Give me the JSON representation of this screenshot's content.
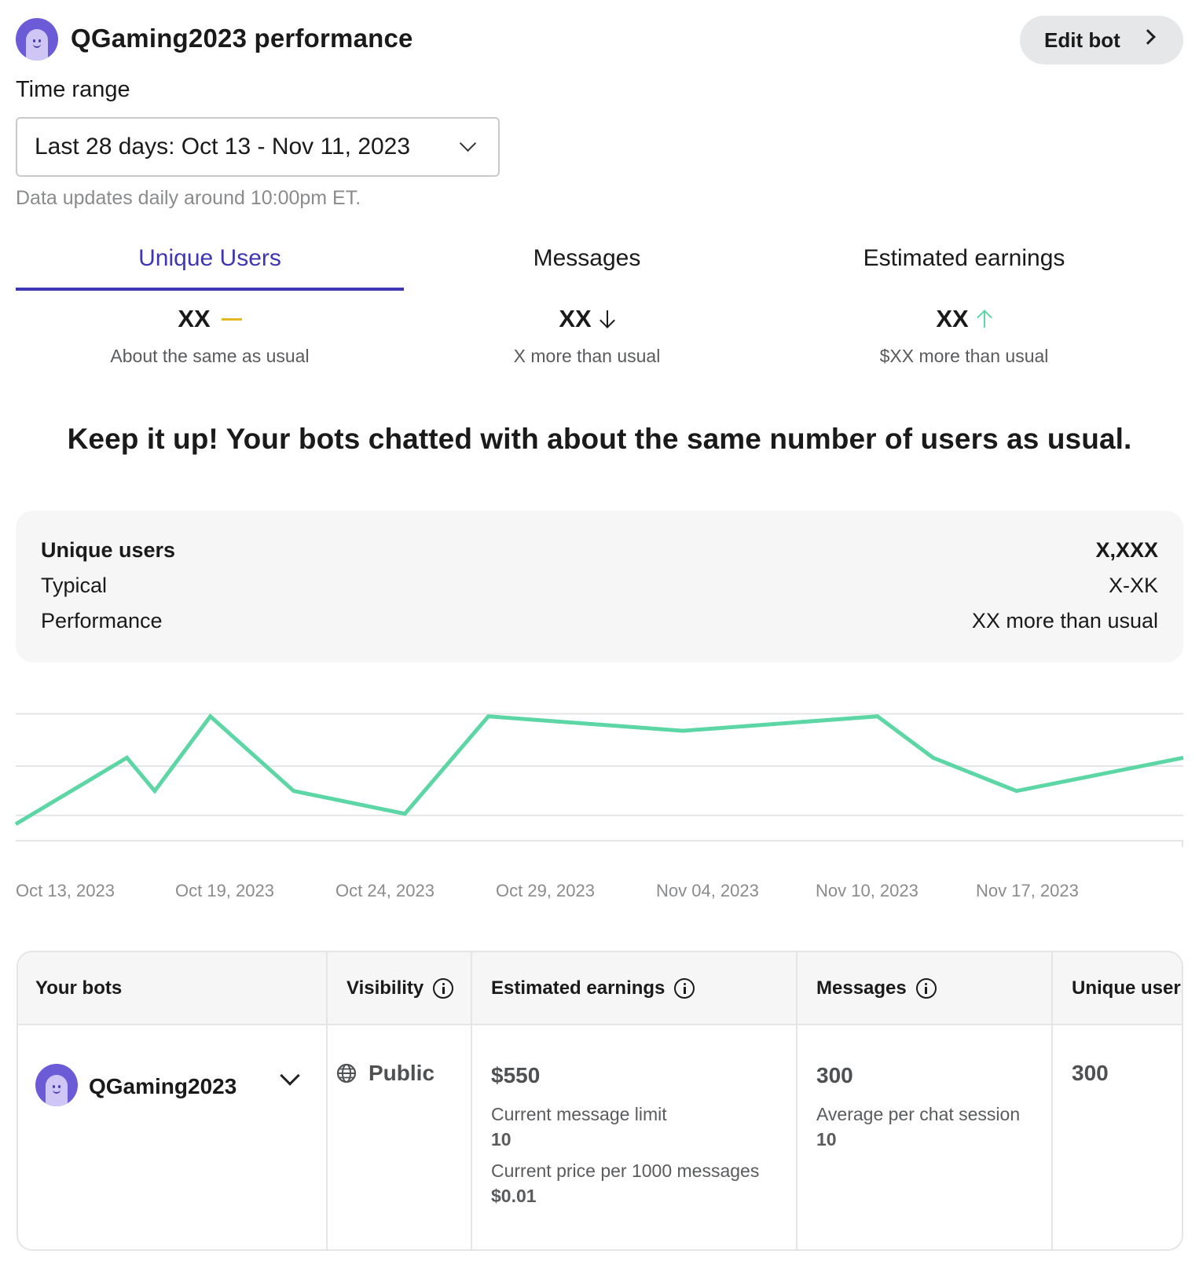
{
  "header": {
    "title": "QGaming2023 performance",
    "edit_label": "Edit bot"
  },
  "time_range": {
    "label": "Time range",
    "selected": "Last 28 days: Oct 13 - Nov 11, 2023",
    "note": "Data updates daily around 10:00pm ET."
  },
  "tabs": [
    {
      "label": "Unique Users",
      "value": "XX",
      "trend": "flat",
      "subtitle": "About the same as usual",
      "active": true
    },
    {
      "label": "Messages",
      "value": "XX",
      "trend": "down",
      "subtitle": "X more than usual",
      "active": false
    },
    {
      "label": "Estimated earnings",
      "value": "XX",
      "trend": "up",
      "subtitle": "$XX more than usual",
      "active": false
    }
  ],
  "headline": "Keep it up! Your bots chatted with about the same number of users as usual.",
  "summary": {
    "rows": [
      {
        "label": "Unique users",
        "value": "X,XXX"
      },
      {
        "label": "Typical",
        "value": "X-XK"
      },
      {
        "label": "Performance",
        "value": "XX more than usual"
      }
    ]
  },
  "colors": {
    "accent": "#3f36b3",
    "line": "#5cd6a5",
    "flat": "#e3b824"
  },
  "chart_data": {
    "type": "line",
    "x_tick_labels": [
      "Oct 13, 2023",
      "Oct 19, 2023",
      "Oct 24, 2023",
      "Oct 29, 2023",
      "Nov 04, 2023",
      "Nov 10, 2023",
      "Nov 17, 2023"
    ],
    "x": [
      "Oct 13, 2023",
      "Oct 17, 2023",
      "Oct 18, 2023",
      "Oct 20, 2023",
      "Oct 23, 2023",
      "Oct 27, 2023",
      "Oct 30, 2023",
      "Nov 06, 2023",
      "Nov 13, 2023",
      "Nov 15, 2023",
      "Nov 18, 2023",
      "Nov 24, 2023"
    ],
    "series": [
      {
        "values": [
          0.4,
          2.0,
          1.2,
          3.0,
          1.2,
          0.65,
          3.0,
          2.65,
          3.0,
          2.0,
          1.2,
          2.0
        ]
      }
    ],
    "ylim": [
      0,
      3.6
    ],
    "grid": true
  },
  "table": {
    "headers": [
      "Your bots",
      "Visibility",
      "Estimated earnings",
      "Messages",
      "Unique users"
    ],
    "rows": [
      {
        "bot_name": "QGaming2023",
        "visibility": "Public",
        "earnings": "$550",
        "earnings_limit_label": "Current message limit",
        "earnings_limit_value": "10",
        "earnings_price_label": "Current price per 1000 messages",
        "earnings_price_value": "$0.01",
        "messages": "300",
        "messages_avg_label": "Average per chat session",
        "messages_avg_value": "10",
        "unique_users": "300"
      }
    ]
  }
}
